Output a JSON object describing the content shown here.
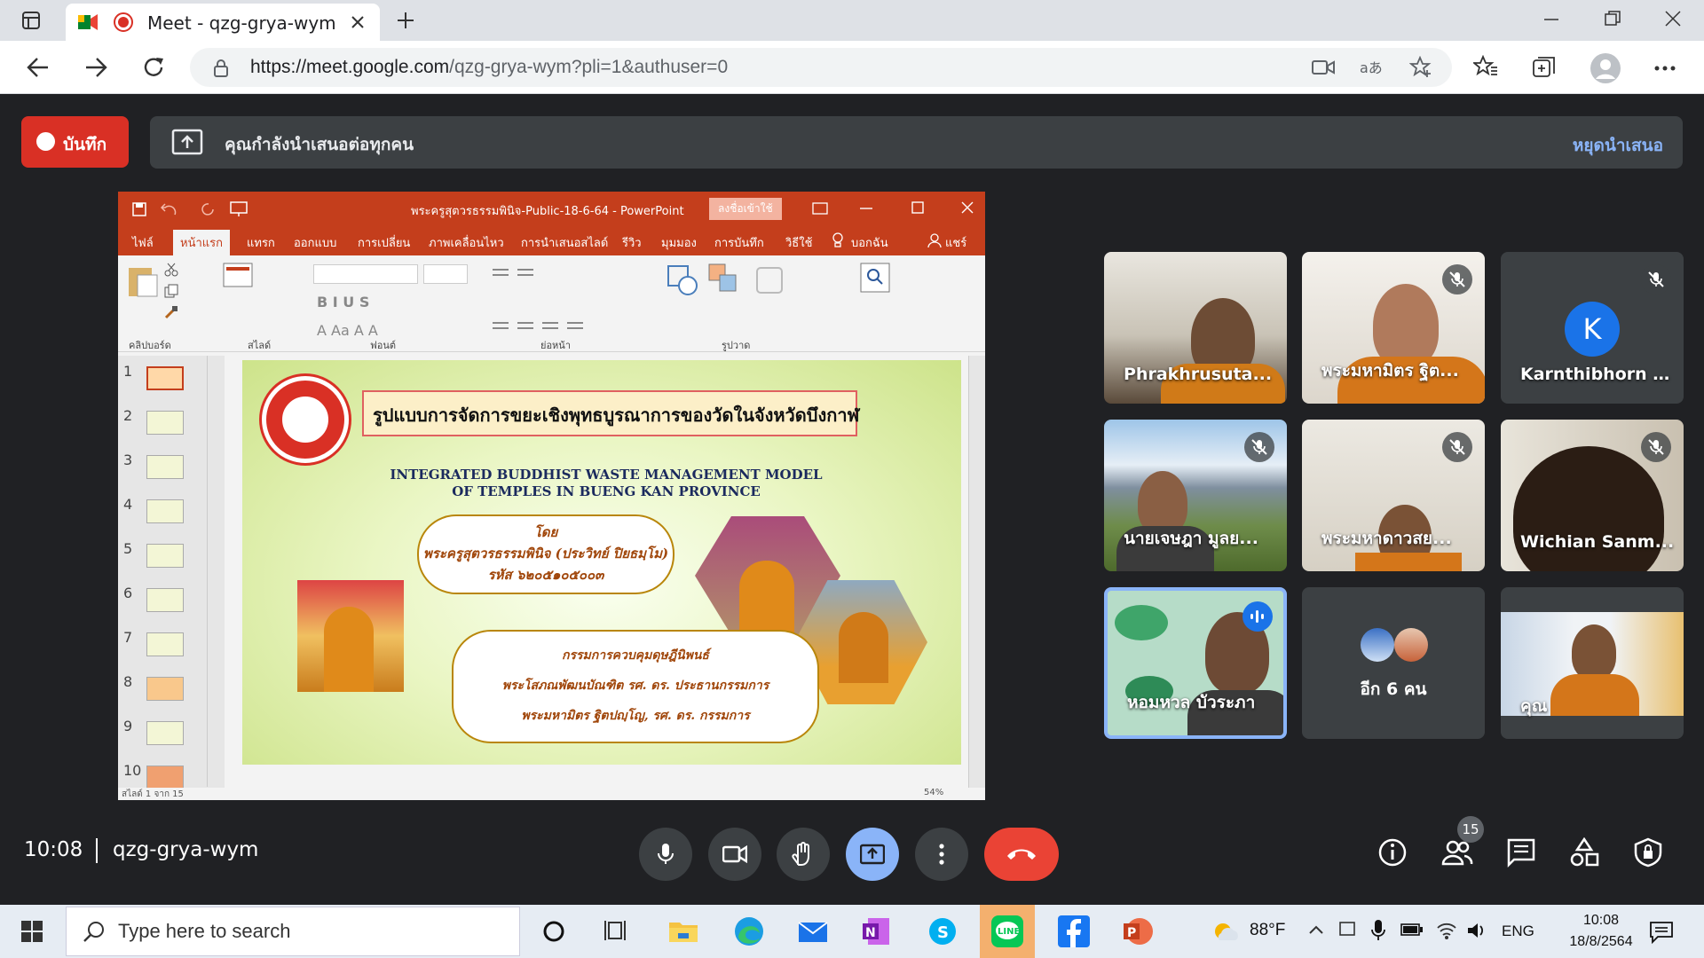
{
  "browser": {
    "tab_title": "Meet - qzg-grya-wym",
    "url_host": "https://meet.google.com",
    "url_path": "/qzg-grya-wym?pli=1&authuser=0"
  },
  "banner": {
    "record_label": "บันทึก",
    "presenting_text": "คุณกำลังนำเสนอต่อทุกคน",
    "stop_label": "หยุดนำเสนอ"
  },
  "powerpoint": {
    "file_title": "พระครูสุตวรธรรมพินิจ-Public-18-6-64  -  PowerPoint",
    "signin_label": "ลงชื่อเข้าใช้",
    "tabs": [
      "ไฟล์",
      "หน้าแรก",
      "แทรก",
      "ออกแบบ",
      "การเปลี่ยน",
      "ภาพเคลื่อนไหว",
      "การนำเสนอสไลด์",
      "รีวิว",
      "มุมมอง",
      "การบันทึก",
      "วิธีใช้",
      "บอกฉัน",
      "แชร์"
    ],
    "groups": [
      "คลิปบอร์ด",
      "สไลด์",
      "ฟอนต์",
      "ย่อหน้า",
      "รูปวาด"
    ],
    "thumbnail_numbers": [
      "1",
      "2",
      "3",
      "4",
      "5",
      "6",
      "7",
      "8",
      "9",
      "10"
    ],
    "status_text": "สไลด์ 1 จาก 15",
    "zoom": "54%"
  },
  "slide": {
    "title": "รูปแบบการจัดการขยะเชิงพุทธบูรณาการของวัดในจังหวัดบึงกาฬ",
    "english_line1": "INTEGRATED BUDDHIST WASTE MANAGEMENT MODEL",
    "english_line2": "OF TEMPLES IN BUENG KAN PROVINCE",
    "by_label": "โดย",
    "author": "พระครูสุตวรธรรมพินิจ (ประวิทย์ ปิยธมฺโม)",
    "student_id": "รหัส ๖๒๐๕๑๐๕๐๐๓",
    "committee_heading": "กรรมการควบคุมดุษฎีนิพนธ์",
    "committee_1": "พระโสภณพัฒนบัณฑิต รศ. ดร. ประธานกรรมการ",
    "committee_2": "พระมหามิตร ฐิตปญฺโญ, รศ. ดร.   กรรมการ"
  },
  "participants": [
    {
      "name": "Phrakhrusuta...",
      "muted": false
    },
    {
      "name": "พระมหามิตร ฐิต...",
      "muted": true
    },
    {
      "name": "Karnthibhorn C...",
      "muted": true,
      "initial": "K",
      "avatar_color": "#1a73e8"
    },
    {
      "name": "นายเจษฎา มูลย...",
      "muted": true
    },
    {
      "name": "พระมหาดาวสย...",
      "muted": true
    },
    {
      "name": "Wichian Sanm...",
      "muted": true
    },
    {
      "name": "หอมหวล บัวระภา",
      "muted": false,
      "speaking": true
    },
    {
      "name": "อีก 6 คน",
      "muted": false
    },
    {
      "name": "คุณ",
      "muted": false
    }
  ],
  "bottom_bar": {
    "time": "10:08",
    "meeting_code": "qzg-grya-wym",
    "people_count": "15"
  },
  "taskbar": {
    "search_placeholder": "Type here to search",
    "weather": "88°F",
    "language": "ENG",
    "time": "10:08",
    "date": "18/8/2564"
  },
  "colors": {
    "meet_bg": "#202124",
    "record_red": "#d93025",
    "present_blue": "#8ab4f8",
    "ppt_orange": "#c43e1c",
    "end_call_red": "#ea4335"
  }
}
